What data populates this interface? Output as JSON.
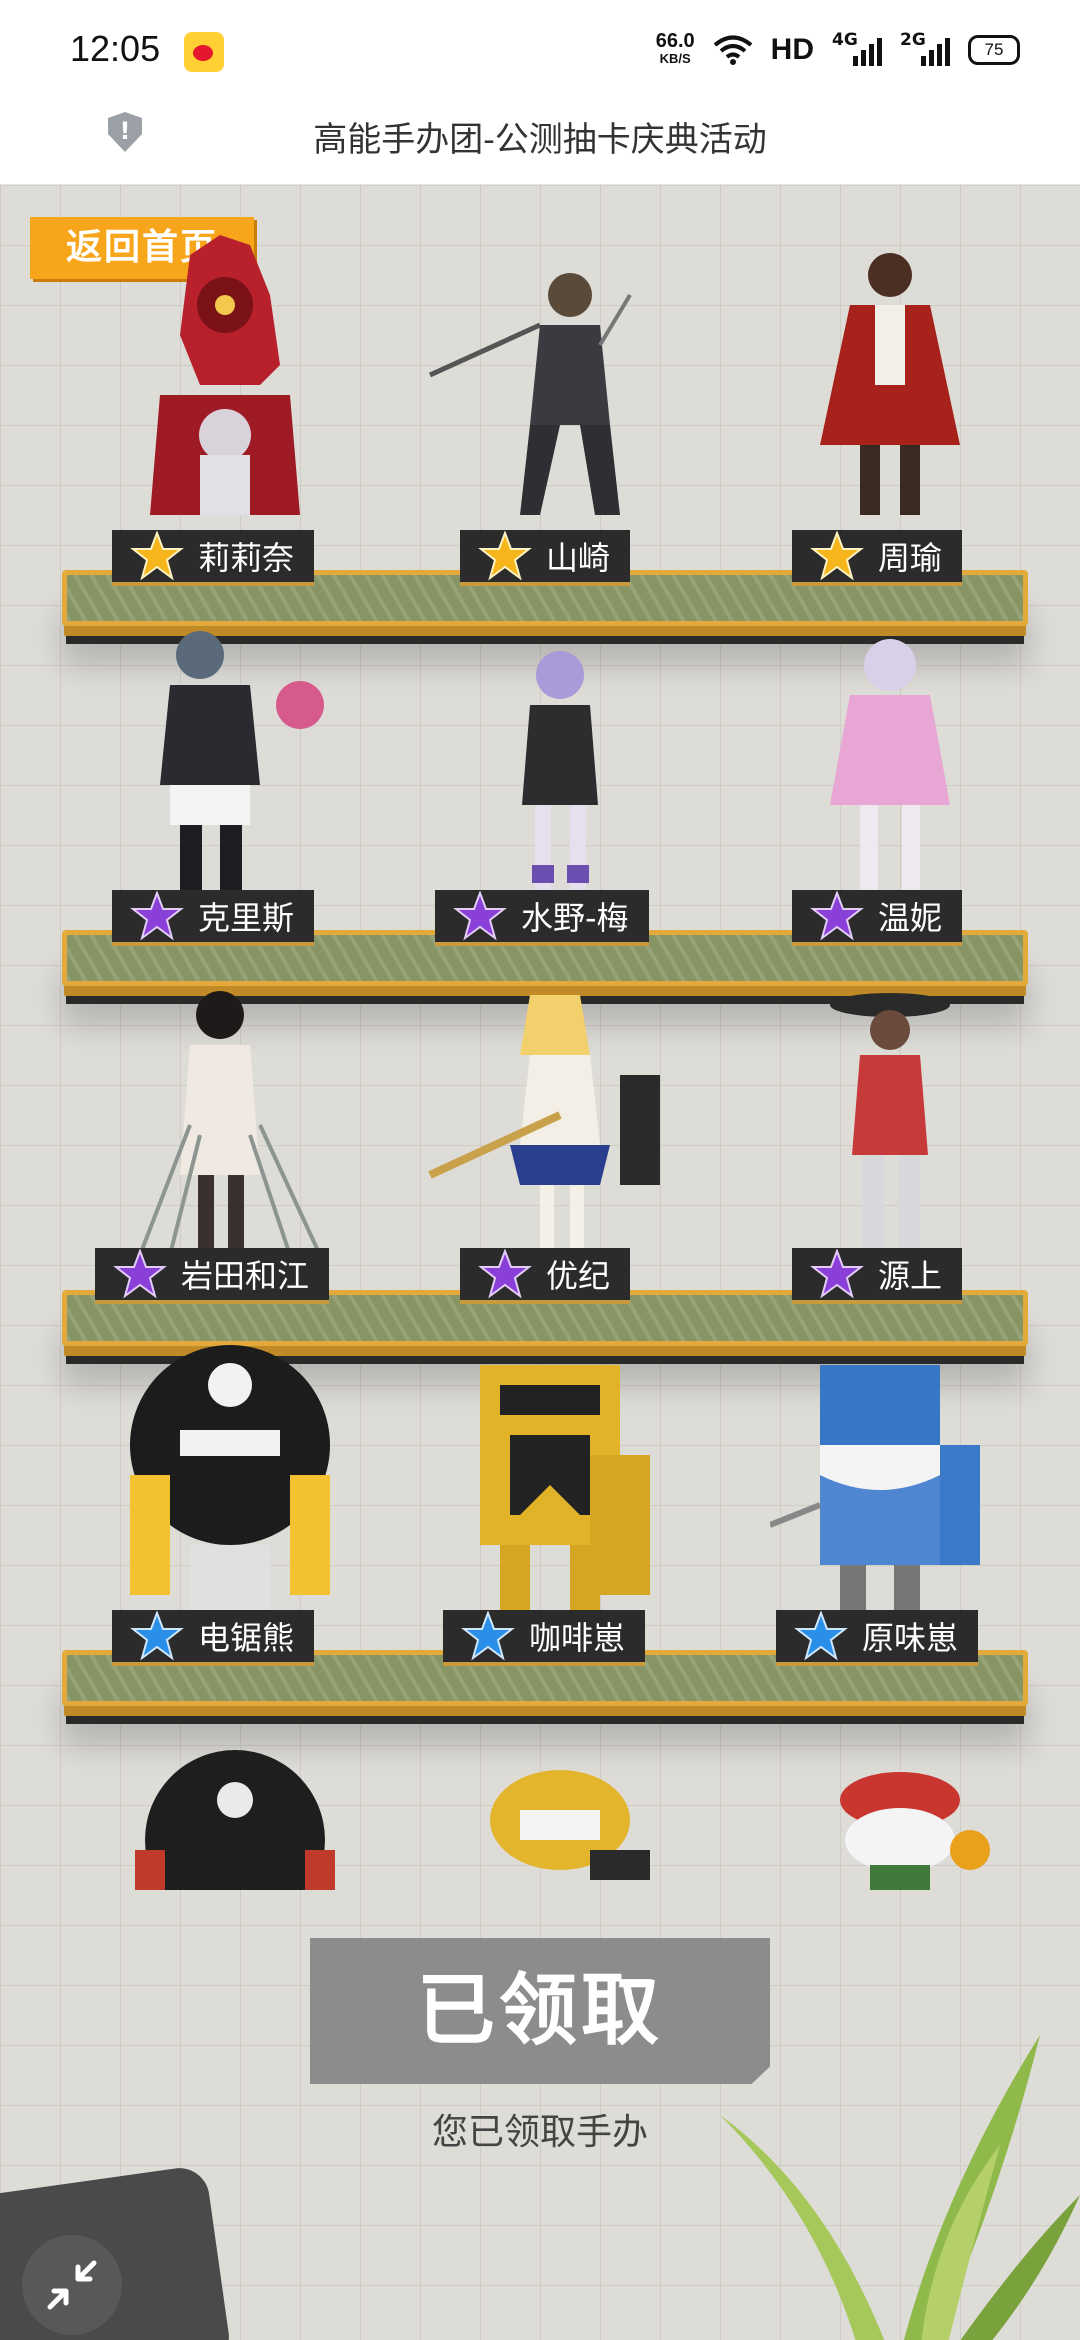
{
  "status_bar": {
    "time": "12:05",
    "speed_value": "66.0",
    "speed_unit": "KB/S",
    "hd_label": "HD",
    "net1": "4G",
    "net2": "2G",
    "battery": "75"
  },
  "title_bar": {
    "title": "高能手办团-公测抽卡庆典活动"
  },
  "page": {
    "back_label": "返回首页",
    "claim_button_label": "已领取",
    "claimed_message": "您已领取手办"
  },
  "star_colors": {
    "gold": "#f5b51b",
    "purple": "#8a3fd8",
    "blue": "#2a8fe8"
  },
  "figures": [
    {
      "name": "莉莉奈",
      "rarity": "gold"
    },
    {
      "name": "山崎",
      "rarity": "gold"
    },
    {
      "name": "周瑜",
      "rarity": "gold"
    },
    {
      "name": "克里斯",
      "rarity": "purple"
    },
    {
      "name": "水野-梅",
      "rarity": "purple"
    },
    {
      "name": "温妮",
      "rarity": "purple"
    },
    {
      "name": "岩田和江",
      "rarity": "purple"
    },
    {
      "name": "优纪",
      "rarity": "purple"
    },
    {
      "name": "源上",
      "rarity": "purple"
    },
    {
      "name": "电锯熊",
      "rarity": "blue"
    },
    {
      "name": "咖啡崽",
      "rarity": "blue"
    },
    {
      "name": "原味崽",
      "rarity": "blue"
    }
  ]
}
